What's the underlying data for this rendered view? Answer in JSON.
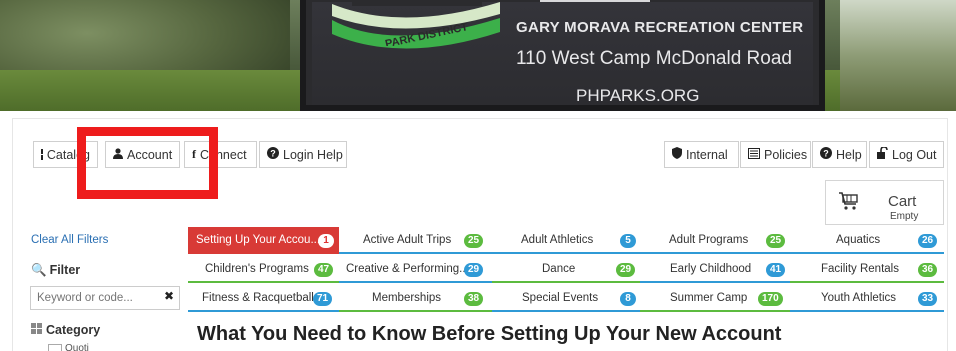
{
  "banner": {
    "logo_text": "PARK DISTRICT",
    "line1": "GARY MORAVA RECREATION CENTER",
    "line2": "110 West Camp McDonald Road",
    "line3": "PHPARKS.ORG"
  },
  "toolbar_left": [
    {
      "label": "Catalog",
      "icon": "grid-icon"
    },
    {
      "label": "Account",
      "icon": "user-icon"
    },
    {
      "label": "Connect",
      "icon": "facebook-icon"
    },
    {
      "label": "Login Help",
      "icon": "question-circle-icon"
    }
  ],
  "toolbar_right": [
    {
      "label": "Internal",
      "icon": "shield-icon"
    },
    {
      "label": "Policies",
      "icon": "document-icon"
    },
    {
      "label": "Help",
      "icon": "question-circle-icon"
    },
    {
      "label": "Log Out",
      "icon": "unlock-icon"
    }
  ],
  "cart": {
    "label": "Cart",
    "status": "Empty"
  },
  "sidebar": {
    "clear_filters": "Clear All Filters",
    "filter_label": "Filter",
    "keyword_placeholder": "Keyword or code...",
    "category_label": "Category",
    "category_first": "Quoti"
  },
  "tabs": [
    {
      "label": "Setting Up Your Accou...",
      "count": "1",
      "active": true
    },
    {
      "label": "Active Adult Trips",
      "count": "25",
      "color": "green"
    },
    {
      "label": "Adult Athletics",
      "count": "5",
      "color": "blue"
    },
    {
      "label": "Adult Programs",
      "count": "25",
      "color": "green"
    },
    {
      "label": "Aquatics",
      "count": "26",
      "color": "blue"
    },
    {
      "label": "Children's Programs",
      "count": "47",
      "color": "green"
    },
    {
      "label": "Creative & Performing...",
      "count": "29",
      "color": "blue"
    },
    {
      "label": "Dance",
      "count": "29",
      "color": "green"
    },
    {
      "label": "Early Childhood",
      "count": "41",
      "color": "blue"
    },
    {
      "label": "Facility Rentals",
      "count": "36",
      "color": "green"
    },
    {
      "label": "Fitness & Racquetball",
      "count": "71",
      "color": "blue"
    },
    {
      "label": "Memberships",
      "count": "38",
      "color": "green"
    },
    {
      "label": "Special Events",
      "count": "8",
      "color": "blue"
    },
    {
      "label": "Summer Camp",
      "count": "170",
      "color": "green"
    },
    {
      "label": "Youth Athletics",
      "count": "33",
      "color": "blue"
    }
  ],
  "main": {
    "heading": "What You Need to Know Before Setting Up Your New Account"
  },
  "colors": {
    "accent_red": "#d83a36",
    "badge_green": "#5cbb3f",
    "badge_blue": "#2f9ad6",
    "highlight": "#ee1c1c"
  }
}
